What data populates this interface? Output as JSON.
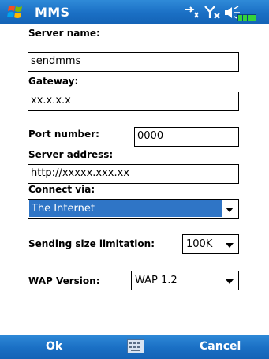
{
  "title_bar": {
    "title": "MMS",
    "icons": [
      "windows-start-icon",
      "data-connection-icon",
      "signal-icon",
      "volume-icon",
      "battery-icon"
    ]
  },
  "form": {
    "server_name": {
      "label": "Server name:",
      "value": "sendmms"
    },
    "gateway": {
      "label": "Gateway:",
      "value": "xx.x.x.x"
    },
    "port_number": {
      "label": "Port number:",
      "value": "0000"
    },
    "server_address": {
      "label": "Server address:",
      "value": "http://xxxxx.xxx.xx"
    },
    "connect_via": {
      "label": "Connect via:",
      "value": "The Internet"
    },
    "sending_size": {
      "label": "Sending size limitation:",
      "value": "100K"
    },
    "wap_version": {
      "label": "WAP Version:",
      "value": "WAP 1.2"
    }
  },
  "soft_keys": {
    "left": "Ok",
    "right": "Cancel"
  },
  "colors": {
    "title_bar": "#1a6fc4",
    "selection": "#2f75c6"
  }
}
